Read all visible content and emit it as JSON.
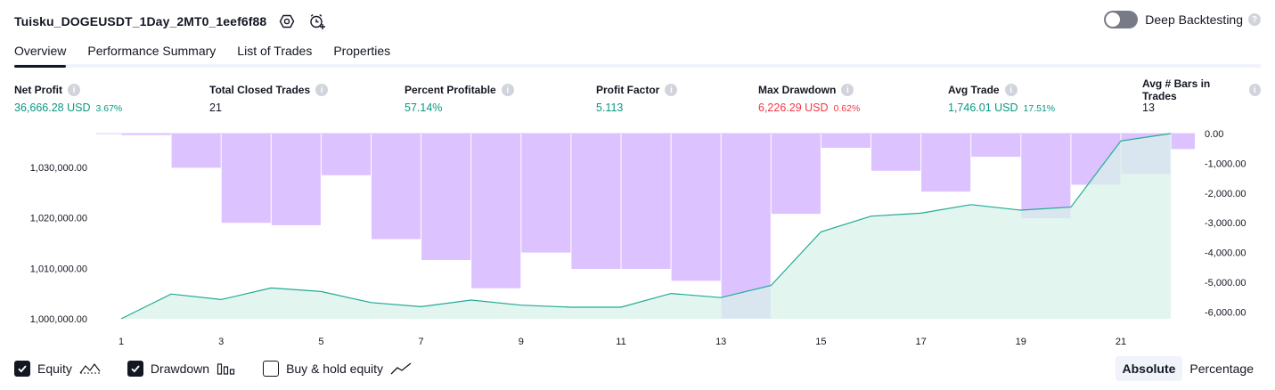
{
  "header": {
    "strategy_name": "Tuisku_DOGEUSDT_1Day_2MT0_1eef6f88",
    "deep_backtesting_label": "Deep Backtesting",
    "deep_backtesting_enabled": false
  },
  "tabs": [
    {
      "label": "Overview",
      "active": true
    },
    {
      "label": "Performance Summary",
      "active": false
    },
    {
      "label": "List of Trades",
      "active": false
    },
    {
      "label": "Properties",
      "active": false
    }
  ],
  "metrics": [
    {
      "label": "Net Profit",
      "value": "36,666.28 USD",
      "pct": "3.67%",
      "color": "green"
    },
    {
      "label": "Total Closed Trades",
      "value": "21",
      "pct": "",
      "color": "neutral"
    },
    {
      "label": "Percent Profitable",
      "value": "57.14%",
      "pct": "",
      "color": "green"
    },
    {
      "label": "Profit Factor",
      "value": "5.113",
      "pct": "",
      "color": "green"
    },
    {
      "label": "Max Drawdown",
      "value": "6,226.29 USD",
      "pct": "0.62%",
      "color": "red"
    },
    {
      "label": "Avg Trade",
      "value": "1,746.01 USD",
      "pct": "17.51%",
      "color": "green"
    },
    {
      "label": "Avg # Bars in Trades",
      "value": "13",
      "pct": "",
      "color": "neutral"
    }
  ],
  "chart_data": {
    "type": "line+bar",
    "x": [
      1,
      2,
      3,
      4,
      5,
      6,
      7,
      8,
      9,
      10,
      11,
      12,
      13,
      14,
      15,
      16,
      17,
      18,
      19,
      20,
      21,
      22
    ],
    "x_ticks": [
      "1",
      "3",
      "5",
      "7",
      "9",
      "11",
      "13",
      "15",
      "17",
      "19",
      "21"
    ],
    "series": [
      {
        "name": "Equity",
        "type": "area",
        "axis": "left",
        "color": "#22ab94",
        "values": [
          1000000,
          1004900,
          1003800,
          1006100,
          1005400,
          1003200,
          1002400,
          1003700,
          1002700,
          1002300,
          1002300,
          1005000,
          1004200,
          1006600,
          1017200,
          1020300,
          1020900,
          1022600,
          1021500,
          1022100,
          1035200,
          1036666.28
        ]
      },
      {
        "name": "Drawdown",
        "type": "bar",
        "axis": "right",
        "color": "#ce93d8",
        "values": [
          -50,
          -1150,
          -3000,
          -3080,
          -1400,
          -3550,
          -4250,
          -5200,
          -4000,
          -4550,
          -4550,
          -4950,
          -6226.29,
          -2700,
          -480,
          -1250,
          -1950,
          -780,
          -2850,
          -1720,
          -1360,
          -520
        ]
      }
    ],
    "left_axis_ticks": [
      "1,000,000.00",
      "1,010,000.00",
      "1,020,000.00",
      "1,030,000.00"
    ],
    "right_axis_ticks": [
      "0.00",
      "-1,000.00",
      "-2,000.00",
      "-3,000.00",
      "-4,000.00",
      "-5,000.00",
      "-6,000.00"
    ],
    "left_ylim": [
      1000000,
      1036666.28
    ],
    "right_ylim": [
      -6226.29,
      0
    ]
  },
  "legend": [
    {
      "label": "Equity",
      "checked": true,
      "icon": "equity-line-icon"
    },
    {
      "label": "Drawdown",
      "checked": true,
      "icon": "drawdown-bars-icon"
    },
    {
      "label": "Buy & hold equity",
      "checked": false,
      "icon": "buy-hold-line-icon"
    }
  ],
  "mode": {
    "absolute_label": "Absolute",
    "percentage_label": "Percentage",
    "active": "absolute"
  },
  "colors": {
    "positive": "#089981",
    "negative": "#f23645",
    "equity_line": "#22ab94",
    "equity_fill": "#d8f1ea",
    "drawdown_bar": "#dcc2ff"
  }
}
